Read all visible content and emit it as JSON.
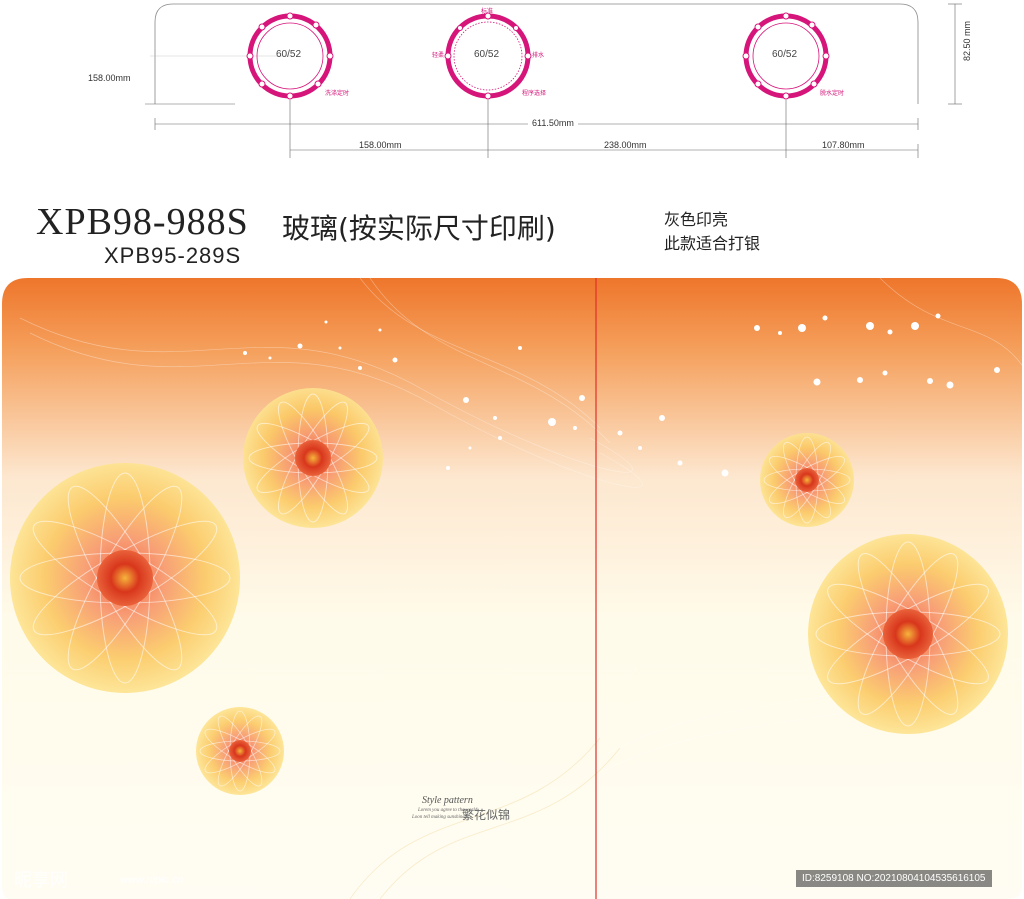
{
  "spec": {
    "dim_height": "158.00mm",
    "dim_total": "611.50mm",
    "dim_seg1": "158.00mm",
    "dim_seg2": "238.00mm",
    "dim_seg3": "107.80mm",
    "dim_right": "82.50 mm",
    "dials": [
      {
        "value": "60/52",
        "label": "洗涤定时"
      },
      {
        "value": "60/52",
        "label": "程序选择",
        "top": "标准",
        "left": "轻柔",
        "right": "排水"
      },
      {
        "value": "60/52",
        "label": "脱水定时"
      }
    ]
  },
  "header": {
    "model_main": "XPB98-988S",
    "model_desc": "玻璃(按实际尺寸印刷)",
    "model_sub": "XPB95-289S",
    "note_line1": "灰色印亮",
    "note_line2": "此款适合打银"
  },
  "panel": {
    "slogan_title": "Style pattern",
    "slogan_sub1": "Lorem you agree to the world",
    "slogan_sub2": "Loon tell making sunshine",
    "slogan_cn": "繁花似锦"
  },
  "watermark": {
    "site": "昵享网",
    "url": "www.nipic.cn",
    "id_text": "ID:8259108 NO:20210804104535616105"
  },
  "colors": {
    "accent_pink": "#d6157a",
    "top_orange": "#ee7a2e",
    "flower_yellow": "#f9c95a"
  }
}
